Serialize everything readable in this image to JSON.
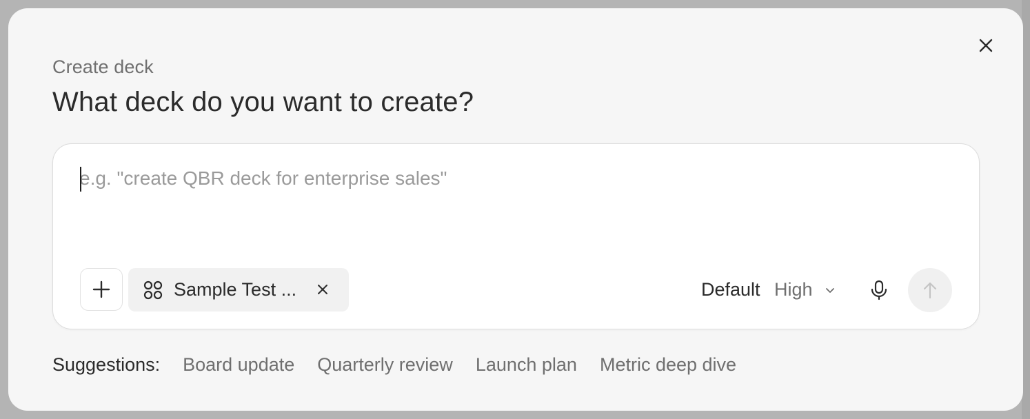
{
  "dialog": {
    "eyebrow": "Create deck",
    "title": "What deck do you want to create?",
    "close_icon": "close-icon"
  },
  "composer": {
    "placeholder": "e.g. \"create QBR deck for enterprise sales\"",
    "value": "",
    "add_icon": "plus-icon",
    "attachment": {
      "icon": "grid-dots-icon",
      "label": "Sample Test ...",
      "remove_icon": "close-icon"
    },
    "model_label": "Default",
    "effort": {
      "selected": "High",
      "icon": "chevron-down-icon"
    },
    "mic_icon": "microphone-icon",
    "send_icon": "arrow-up-icon"
  },
  "suggestions": {
    "label": "Suggestions:",
    "items": [
      "Board update",
      "Quarterly review",
      "Launch plan",
      "Metric deep dive"
    ]
  }
}
